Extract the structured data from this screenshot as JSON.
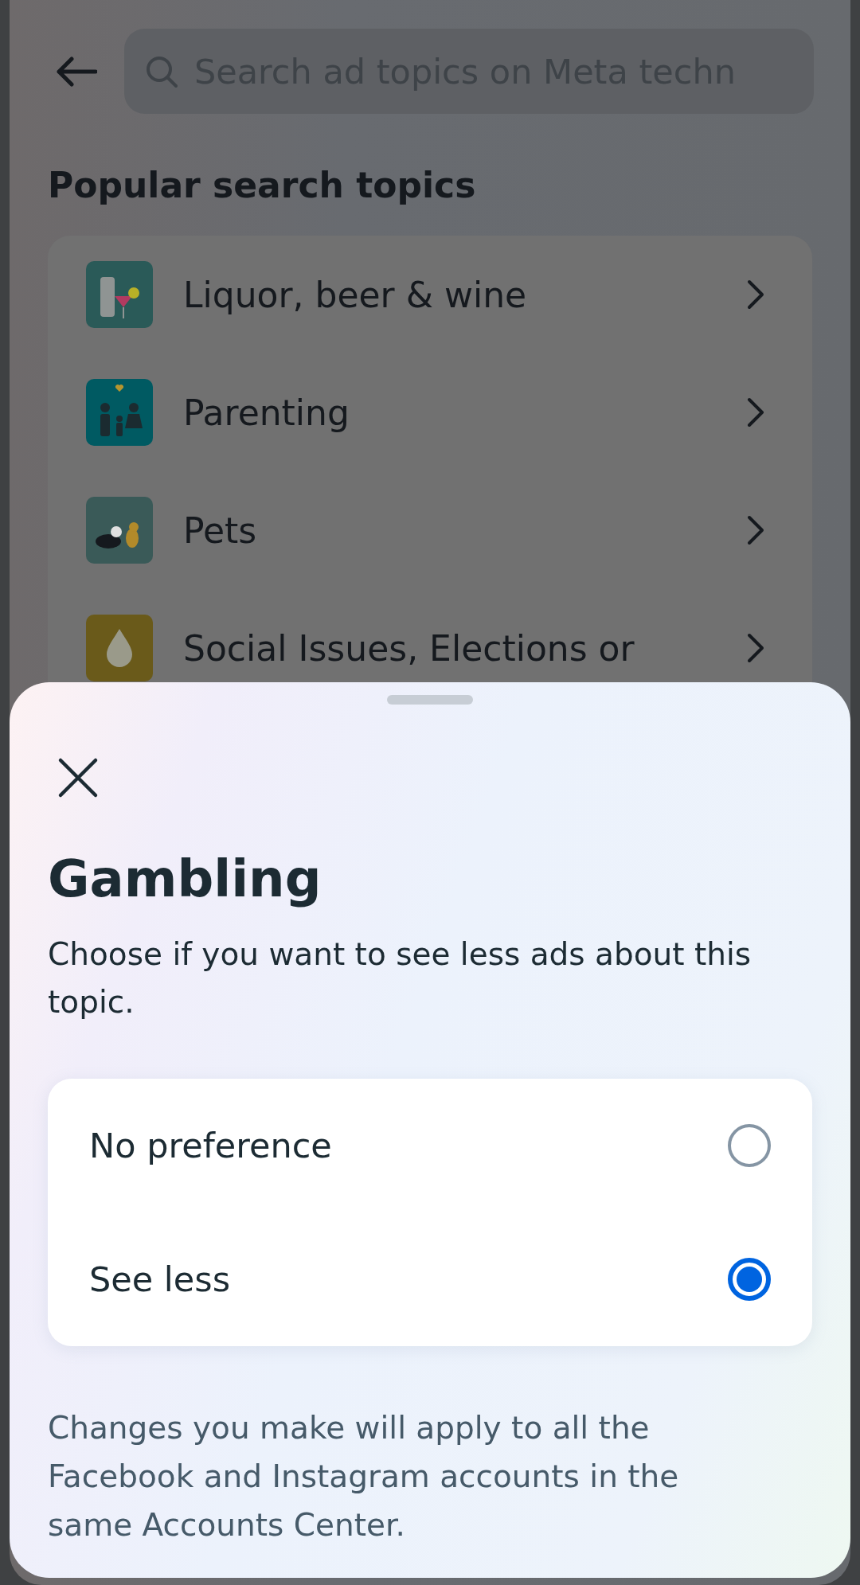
{
  "search": {
    "placeholder": "Search ad topics on Meta techn"
  },
  "heading": "Popular search topics",
  "topics": [
    {
      "label": "Liquor, beer & wine"
    },
    {
      "label": "Parenting"
    },
    {
      "label": "Pets"
    },
    {
      "label": "Social Issues, Elections or"
    }
  ],
  "sheet": {
    "title": "Gambling",
    "description": "Choose if you want to see less ads about this topic.",
    "options": [
      {
        "label": "No preference",
        "selected": false
      },
      {
        "label": "See less",
        "selected": true
      }
    ],
    "footer": "Changes you make will apply to all the Facebook and Instagram accounts in the same Accounts Center."
  }
}
